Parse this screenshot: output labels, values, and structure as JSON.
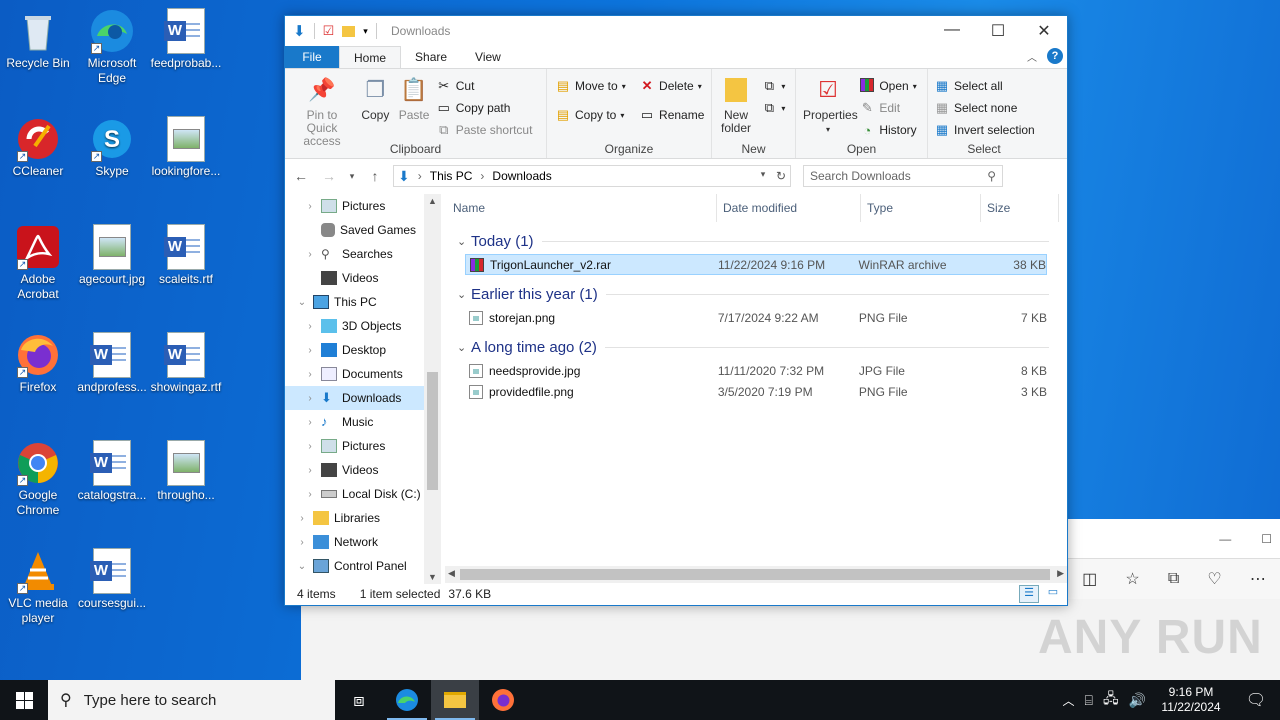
{
  "desktop": {
    "icons": [
      {
        "label": "Recycle Bin"
      },
      {
        "label": "Microsoft Edge"
      },
      {
        "label": "feedprobab..."
      },
      {
        "label": "CCleaner"
      },
      {
        "label": "Skype"
      },
      {
        "label": "lookingfore..."
      },
      {
        "label": "Adobe Acrobat"
      },
      {
        "label": "agecourt.jpg"
      },
      {
        "label": "scaleits.rtf"
      },
      {
        "label": "Firefox"
      },
      {
        "label": "andprofess..."
      },
      {
        "label": "showingaz.rtf"
      },
      {
        "label": "Google Chrome"
      },
      {
        "label": "catalogstra..."
      },
      {
        "label": "througho..."
      },
      {
        "label": "VLC media player"
      },
      {
        "label": "coursesgui..."
      }
    ]
  },
  "explorer": {
    "title": "Downloads",
    "tabs": {
      "file": "File",
      "home": "Home",
      "share": "Share",
      "view": "View"
    },
    "ribbon": {
      "clipboard": {
        "label": "Clipboard",
        "pin": "Pin to Quick access",
        "copy": "Copy",
        "paste": "Paste",
        "cut": "Cut",
        "copy_path": "Copy path",
        "paste_shortcut": "Paste shortcut"
      },
      "organize": {
        "label": "Organize",
        "move_to": "Move to",
        "copy_to": "Copy to",
        "delete": "Delete",
        "rename": "Rename"
      },
      "new": {
        "label": "New",
        "new_folder": "New folder"
      },
      "open": {
        "label": "Open",
        "properties": "Properties",
        "open": "Open",
        "edit": "Edit",
        "history": "History"
      },
      "select": {
        "label": "Select",
        "select_all": "Select all",
        "select_none": "Select none",
        "invert": "Invert selection"
      }
    },
    "address": {
      "crumb1": "This PC",
      "crumb2": "Downloads"
    },
    "search": {
      "placeholder": "Search Downloads"
    },
    "nav": [
      {
        "label": "Pictures"
      },
      {
        "label": "Saved Games"
      },
      {
        "label": "Searches"
      },
      {
        "label": "Videos"
      },
      {
        "label": "This PC"
      },
      {
        "label": "3D Objects"
      },
      {
        "label": "Desktop"
      },
      {
        "label": "Documents"
      },
      {
        "label": "Downloads"
      },
      {
        "label": "Music"
      },
      {
        "label": "Pictures"
      },
      {
        "label": "Videos"
      },
      {
        "label": "Local Disk (C:)"
      },
      {
        "label": "Libraries"
      },
      {
        "label": "Network"
      },
      {
        "label": "Control Panel"
      }
    ],
    "columns": {
      "name": "Name",
      "date": "Date modified",
      "type": "Type",
      "size": "Size"
    },
    "groups": [
      {
        "title": "Today (1)",
        "files": [
          {
            "name": "TrigonLauncher_v2.rar",
            "date": "11/22/2024 9:16 PM",
            "type": "WinRAR archive",
            "size": "38 KB"
          }
        ]
      },
      {
        "title": "Earlier this year (1)",
        "files": [
          {
            "name": "storejan.png",
            "date": "7/17/2024 9:22 AM",
            "type": "PNG File",
            "size": "7 KB"
          }
        ]
      },
      {
        "title": "A long time ago (2)",
        "files": [
          {
            "name": "needsprovide.jpg",
            "date": "11/11/2020 7:32 PM",
            "type": "JPG File",
            "size": "8 KB"
          },
          {
            "name": "providedfile.png",
            "date": "3/5/2020 7:19 PM",
            "type": "PNG File",
            "size": "3 KB"
          }
        ]
      }
    ],
    "status": {
      "count": "4 items",
      "selected": "1 item selected",
      "size": "37.6 KB"
    }
  },
  "taskbar": {
    "search_placeholder": "Type here to search",
    "time": "9:16 PM",
    "date": "11/22/2024"
  },
  "watermark": "ANY RUN"
}
